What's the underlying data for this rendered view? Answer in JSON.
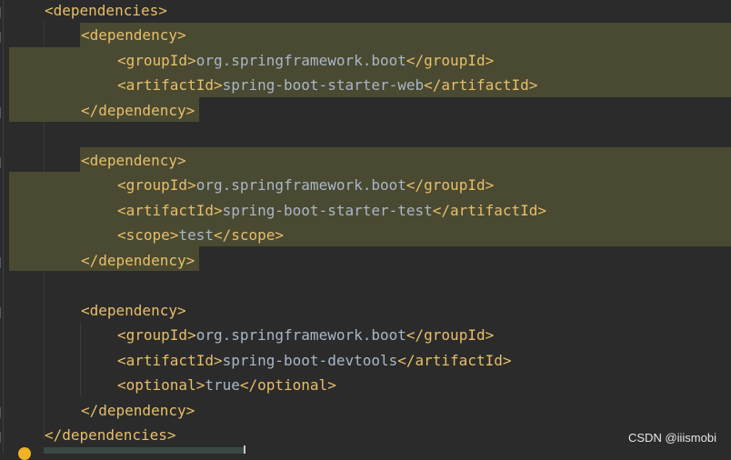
{
  "colors": {
    "background": "#2b2b2b",
    "tag": "#e8bf6a",
    "text": "#a9b7c6",
    "highlight": "#4a4a32"
  },
  "code": {
    "lines": [
      {
        "tag1": "<dependencies>"
      },
      {
        "tag1": "<dependency>"
      },
      {
        "tag1": "<groupId>",
        "text": "org.springframework.boot",
        "tag2": "</groupId>"
      },
      {
        "tag1": "<artifactId>",
        "text": "spring-boot-starter-web",
        "tag2": "</artifactId>"
      },
      {
        "tag1": "</dependency>"
      },
      {
        "tag1": ""
      },
      {
        "tag1": "<dependency>"
      },
      {
        "tag1": "<groupId>",
        "text": "org.springframework.boot",
        "tag2": "</groupId>"
      },
      {
        "tag1": "<artifactId>",
        "text": "spring-boot-starter-test",
        "tag2": "</artifactId>"
      },
      {
        "tag1": "<scope>",
        "text": "test",
        "tag2": "</scope>"
      },
      {
        "tag1": "</dependency>"
      },
      {
        "tag1": ""
      },
      {
        "tag1": "<dependency>"
      },
      {
        "tag1": "<groupId>",
        "text": "org.springframework.boot",
        "tag2": "</groupId>"
      },
      {
        "tag1": "<artifactId>",
        "text": "spring-boot-devtools",
        "tag2": "</artifactId>"
      },
      {
        "tag1": "<optional>",
        "text": "true",
        "tag2": "</optional>"
      },
      {
        "tag1": "</dependency>"
      },
      {
        "tag1": "</dependencies>"
      }
    ]
  },
  "watermark": "CSDN @iiismobi"
}
